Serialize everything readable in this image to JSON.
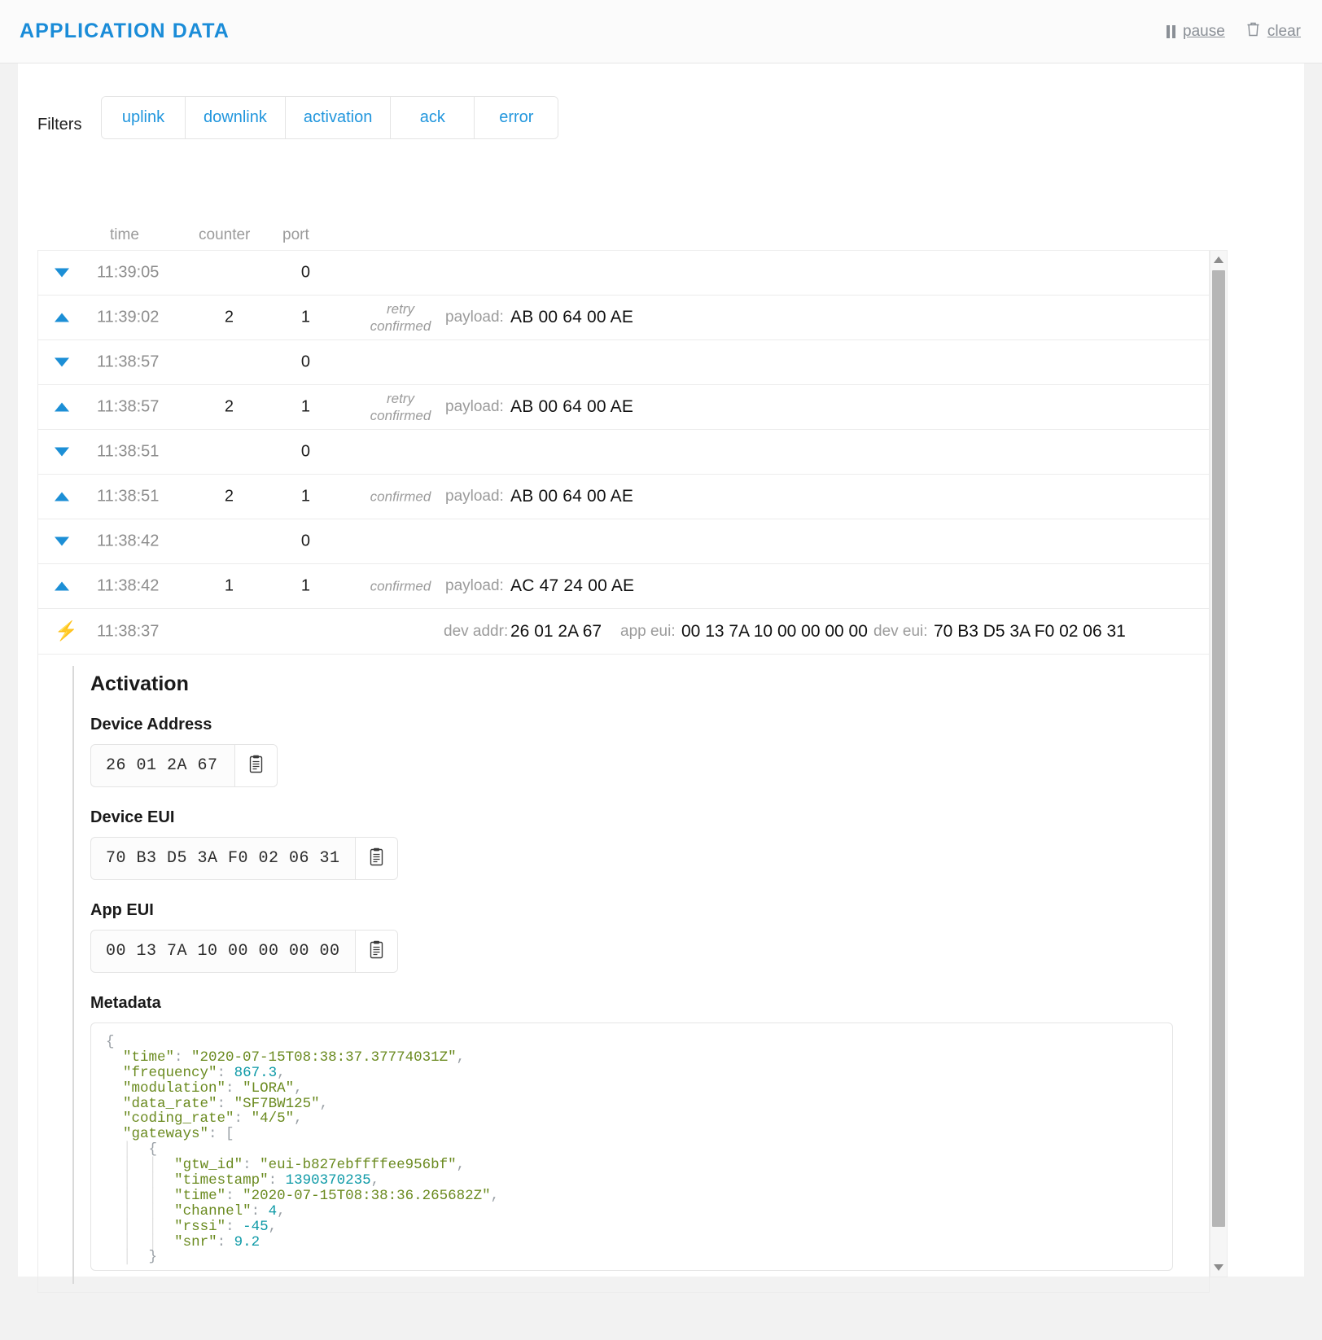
{
  "header": {
    "title": "APPLICATION DATA",
    "pause_label": "pause",
    "clear_label": "clear"
  },
  "filters": {
    "label": "Filters",
    "buttons": [
      "uplink",
      "downlink",
      "activation",
      "ack",
      "error"
    ]
  },
  "table": {
    "columns": {
      "time": "time",
      "counter": "counter",
      "port": "port"
    },
    "payload_label": "payload:",
    "rows": [
      {
        "kind": "downlink",
        "icon": "triangle-down-icon",
        "time": "11:39:05",
        "counter": "",
        "port": "0",
        "flags": "",
        "payload": ""
      },
      {
        "kind": "uplink",
        "icon": "triangle-up-icon",
        "time": "11:39:02",
        "counter": "2",
        "port": "1",
        "flags": "retry\nconfirmed",
        "payload": "AB 00 64 00 AE"
      },
      {
        "kind": "downlink",
        "icon": "triangle-down-icon",
        "time": "11:38:57",
        "counter": "",
        "port": "0",
        "flags": "",
        "payload": ""
      },
      {
        "kind": "uplink",
        "icon": "triangle-up-icon",
        "time": "11:38:57",
        "counter": "2",
        "port": "1",
        "flags": "retry\nconfirmed",
        "payload": "AB 00 64 00 AE"
      },
      {
        "kind": "downlink",
        "icon": "triangle-down-icon",
        "time": "11:38:51",
        "counter": "",
        "port": "0",
        "flags": "",
        "payload": ""
      },
      {
        "kind": "uplink",
        "icon": "triangle-up-icon",
        "time": "11:38:51",
        "counter": "2",
        "port": "1",
        "flags": "confirmed",
        "payload": "AB 00 64 00 AE"
      },
      {
        "kind": "downlink",
        "icon": "triangle-down-icon",
        "time": "11:38:42",
        "counter": "",
        "port": "0",
        "flags": "",
        "payload": ""
      },
      {
        "kind": "uplink",
        "icon": "triangle-up-icon",
        "time": "11:38:42",
        "counter": "1",
        "port": "1",
        "flags": "confirmed",
        "payload": "AC 47 24 00 AE"
      }
    ],
    "activation_row": {
      "icon": "lightning-bolt-icon",
      "time": "11:38:37",
      "dev_addr_label": "dev addr:",
      "dev_addr_value": "26 01 2A 67",
      "app_eui_label": "app eui:",
      "app_eui_value": "00 13 7A 10 00 00 00 00",
      "dev_eui_label": "dev eui:",
      "dev_eui_value": "70 B3 D5 3A F0 02 06 31"
    }
  },
  "detail": {
    "title": "Activation",
    "device_address": {
      "label": "Device Address",
      "value": "26 01 2A 67",
      "copy_icon": "clipboard-icon"
    },
    "device_eui": {
      "label": "Device EUI",
      "value": "70 B3 D5 3A F0 02 06 31",
      "copy_icon": "clipboard-icon"
    },
    "app_eui": {
      "label": "App EUI",
      "value": "00 13 7A 10 00 00 00 00",
      "copy_icon": "clipboard-icon"
    },
    "metadata": {
      "label": "Metadata",
      "json": {
        "time": "2020-07-15T08:38:37.37774031Z",
        "frequency": 867.3,
        "modulation": "LORA",
        "data_rate": "SF7BW125",
        "coding_rate": "4/5",
        "gateways": [
          {
            "gtw_id": "eui-b827ebffffee956bf",
            "timestamp": 1390370235,
            "time": "2020-07-15T08:38:36.265682Z",
            "channel": 4,
            "rssi": -45,
            "snr": 9.2
          }
        ]
      },
      "lines": [
        {
          "indent": 0,
          "parts": [
            {
              "t": "punc",
              "v": "{"
            }
          ]
        },
        {
          "indent": 1,
          "parts": [
            {
              "t": "key",
              "v": "\"time\""
            },
            {
              "t": "punc",
              "v": ": "
            },
            {
              "t": "str",
              "v": "\"2020-07-15T08:38:37.37774031Z\""
            },
            {
              "t": "punc",
              "v": ","
            }
          ]
        },
        {
          "indent": 1,
          "parts": [
            {
              "t": "key",
              "v": "\"frequency\""
            },
            {
              "t": "punc",
              "v": ": "
            },
            {
              "t": "num",
              "v": "867.3"
            },
            {
              "t": "punc",
              "v": ","
            }
          ]
        },
        {
          "indent": 1,
          "parts": [
            {
              "t": "key",
              "v": "\"modulation\""
            },
            {
              "t": "punc",
              "v": ": "
            },
            {
              "t": "str",
              "v": "\"LORA\""
            },
            {
              "t": "punc",
              "v": ","
            }
          ]
        },
        {
          "indent": 1,
          "parts": [
            {
              "t": "key",
              "v": "\"data_rate\""
            },
            {
              "t": "punc",
              "v": ": "
            },
            {
              "t": "str",
              "v": "\"SF7BW125\""
            },
            {
              "t": "punc",
              "v": ","
            }
          ]
        },
        {
          "indent": 1,
          "parts": [
            {
              "t": "key",
              "v": "\"coding_rate\""
            },
            {
              "t": "punc",
              "v": ": "
            },
            {
              "t": "str",
              "v": "\"4/5\""
            },
            {
              "t": "punc",
              "v": ","
            }
          ]
        },
        {
          "indent": 1,
          "parts": [
            {
              "t": "key",
              "v": "\"gateways\""
            },
            {
              "t": "punc",
              "v": ": ["
            }
          ]
        },
        {
          "indent": 2,
          "parts": [
            {
              "t": "punc",
              "v": "{"
            }
          ]
        },
        {
          "indent": 3,
          "parts": [
            {
              "t": "key",
              "v": "\"gtw_id\""
            },
            {
              "t": "punc",
              "v": ": "
            },
            {
              "t": "str",
              "v": "\"eui-b827ebffffee956bf\""
            },
            {
              "t": "punc",
              "v": ","
            }
          ]
        },
        {
          "indent": 3,
          "parts": [
            {
              "t": "key",
              "v": "\"timestamp\""
            },
            {
              "t": "punc",
              "v": ": "
            },
            {
              "t": "num",
              "v": "1390370235"
            },
            {
              "t": "punc",
              "v": ","
            }
          ]
        },
        {
          "indent": 3,
          "parts": [
            {
              "t": "key",
              "v": "\"time\""
            },
            {
              "t": "punc",
              "v": ": "
            },
            {
              "t": "str",
              "v": "\"2020-07-15T08:38:36.265682Z\""
            },
            {
              "t": "punc",
              "v": ","
            }
          ]
        },
        {
          "indent": 3,
          "parts": [
            {
              "t": "key",
              "v": "\"channel\""
            },
            {
              "t": "punc",
              "v": ": "
            },
            {
              "t": "num",
              "v": "4"
            },
            {
              "t": "punc",
              "v": ","
            }
          ]
        },
        {
          "indent": 3,
          "parts": [
            {
              "t": "key",
              "v": "\"rssi\""
            },
            {
              "t": "punc",
              "v": ": "
            },
            {
              "t": "num",
              "v": "-45"
            },
            {
              "t": "punc",
              "v": ","
            }
          ]
        },
        {
          "indent": 3,
          "parts": [
            {
              "t": "key",
              "v": "\"snr\""
            },
            {
              "t": "punc",
              "v": ": "
            },
            {
              "t": "num",
              "v": "9.2"
            }
          ]
        },
        {
          "indent": 2,
          "parts": [
            {
              "t": "punc",
              "v": "}"
            }
          ]
        }
      ]
    }
  },
  "colors": {
    "accent": "#1a8cd8",
    "link": "#2196dd",
    "bolt": "#f5b731",
    "muted": "#9b9b9b",
    "json_key": "#6a8a1f",
    "json_num": "#0e9aa7"
  }
}
